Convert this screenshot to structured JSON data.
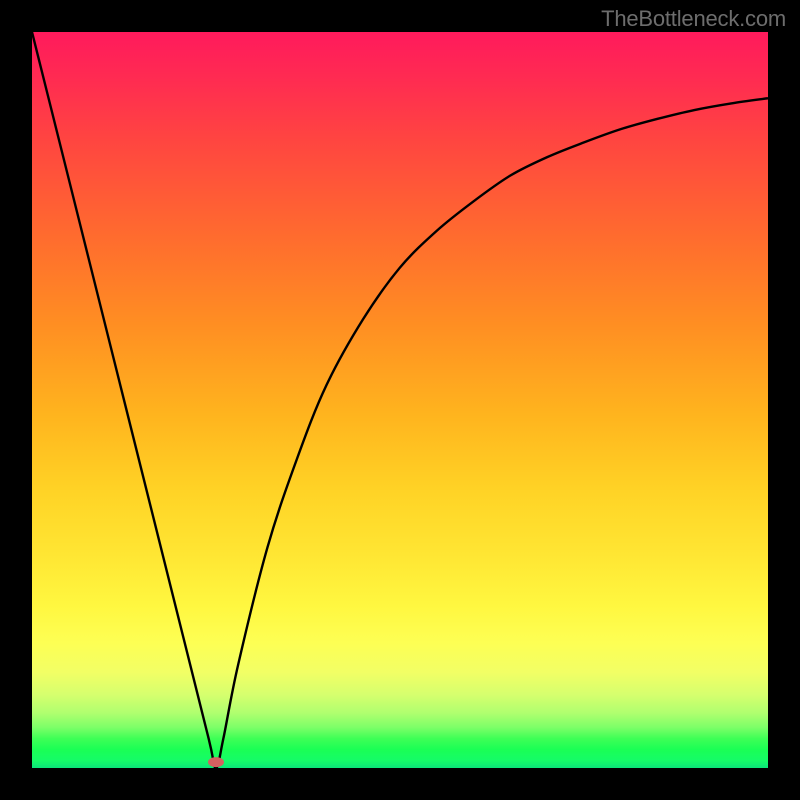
{
  "watermark": "TheBottleneck.com",
  "chart_data": {
    "type": "line",
    "title": "",
    "xlabel": "",
    "ylabel": "",
    "xlim": [
      0,
      100
    ],
    "ylim": [
      0,
      100
    ],
    "grid": false,
    "legend": false,
    "background": {
      "type": "vertical-gradient",
      "stops": [
        {
          "pos": 0,
          "color": "#ff1a5c"
        },
        {
          "pos": 30,
          "color": "#ff7a28"
        },
        {
          "pos": 60,
          "color": "#ffd225"
        },
        {
          "pos": 80,
          "color": "#fdff54"
        },
        {
          "pos": 95,
          "color": "#3eff56"
        },
        {
          "pos": 100,
          "color": "#0be47a"
        }
      ]
    },
    "series": [
      {
        "name": "bottleneck-curve",
        "color": "#000000",
        "x": [
          0,
          4,
          8,
          12,
          16,
          20,
          24,
          25,
          26,
          28,
          32,
          36,
          40,
          45,
          50,
          55,
          60,
          65,
          70,
          75,
          80,
          85,
          90,
          95,
          100
        ],
        "y": [
          100,
          84,
          68,
          52,
          36,
          20,
          4,
          0,
          4,
          14,
          30,
          42,
          52,
          61,
          68,
          73,
          77,
          80.5,
          83,
          85,
          86.8,
          88.2,
          89.4,
          90.3,
          91
        ]
      }
    ],
    "markers": [
      {
        "name": "minimum-point",
        "x": 25,
        "y": 0.8,
        "color": "#d56060",
        "shape": "ellipse"
      }
    ]
  }
}
